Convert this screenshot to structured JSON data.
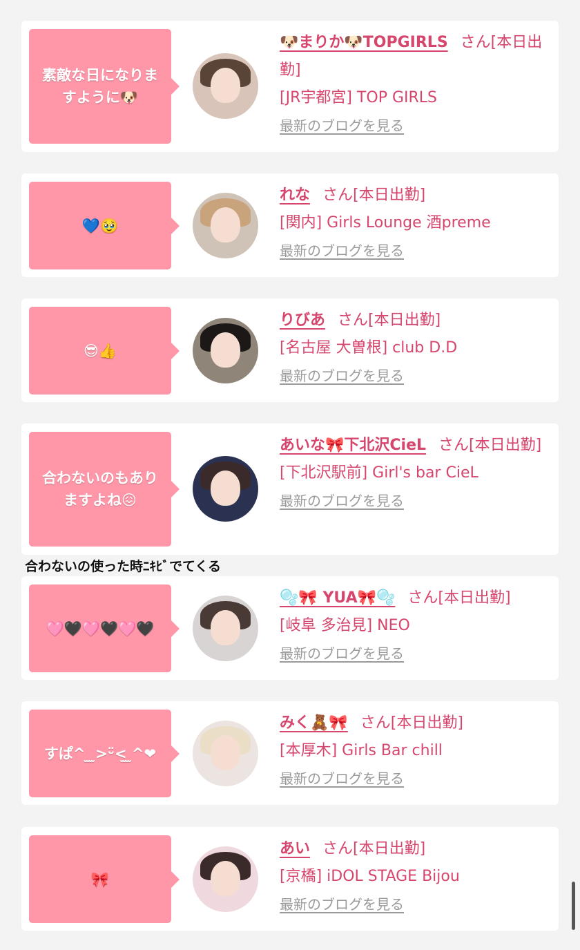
{
  "caption_overlay": "合わないの使った時ﾆｷﾋﾞでてくる",
  "blog_link_label": "最新のブログを見る",
  "colors": {
    "bubble": "#ff97a9",
    "accent": "#d6456c",
    "link_gray": "#9a9a9a"
  },
  "cards": [
    {
      "message": "素敵な日になりますように🐶",
      "name": "🐶まりか🐶TOPGIRLS",
      "suffix": "さん[本日出勤]",
      "shop": "[JR宇都宮] TOP GIRLS"
    },
    {
      "message": "💙🥹",
      "name": "れな",
      "suffix": "さん[本日出勤]",
      "shop": "[関内] Girls Lounge 酒preme"
    },
    {
      "message": "😎👍",
      "name": "りびあ",
      "suffix": "さん[本日出勤]",
      "shop": "[名古屋 大曽根] club D.D"
    },
    {
      "message": "合わないのもありますよね😖",
      "name": "あいな🎀下北沢CieL",
      "suffix": "さん[本日出勤]",
      "shop": "[下北沢駅前] Girl's bar CieL"
    },
    {
      "message": "🩷🖤🩷🖤🩷🖤",
      "name": "🫧🎀 YUA🎀🫧",
      "suffix": "さん[本日出勤]",
      "shop": "[岐阜 多治見] NEO"
    },
    {
      "message": "すぱ^ ̫ ̫>ᵕ̈<̫ ̫^❤",
      "name": "みく🧸🎀",
      "suffix": "さん[本日出勤]",
      "shop": "[本厚木] Girls Bar chill"
    },
    {
      "message": "🎀",
      "name": "あい",
      "suffix": "さん[本日出勤]",
      "shop": "[京橋] iDOL STAGE Bijou"
    }
  ]
}
